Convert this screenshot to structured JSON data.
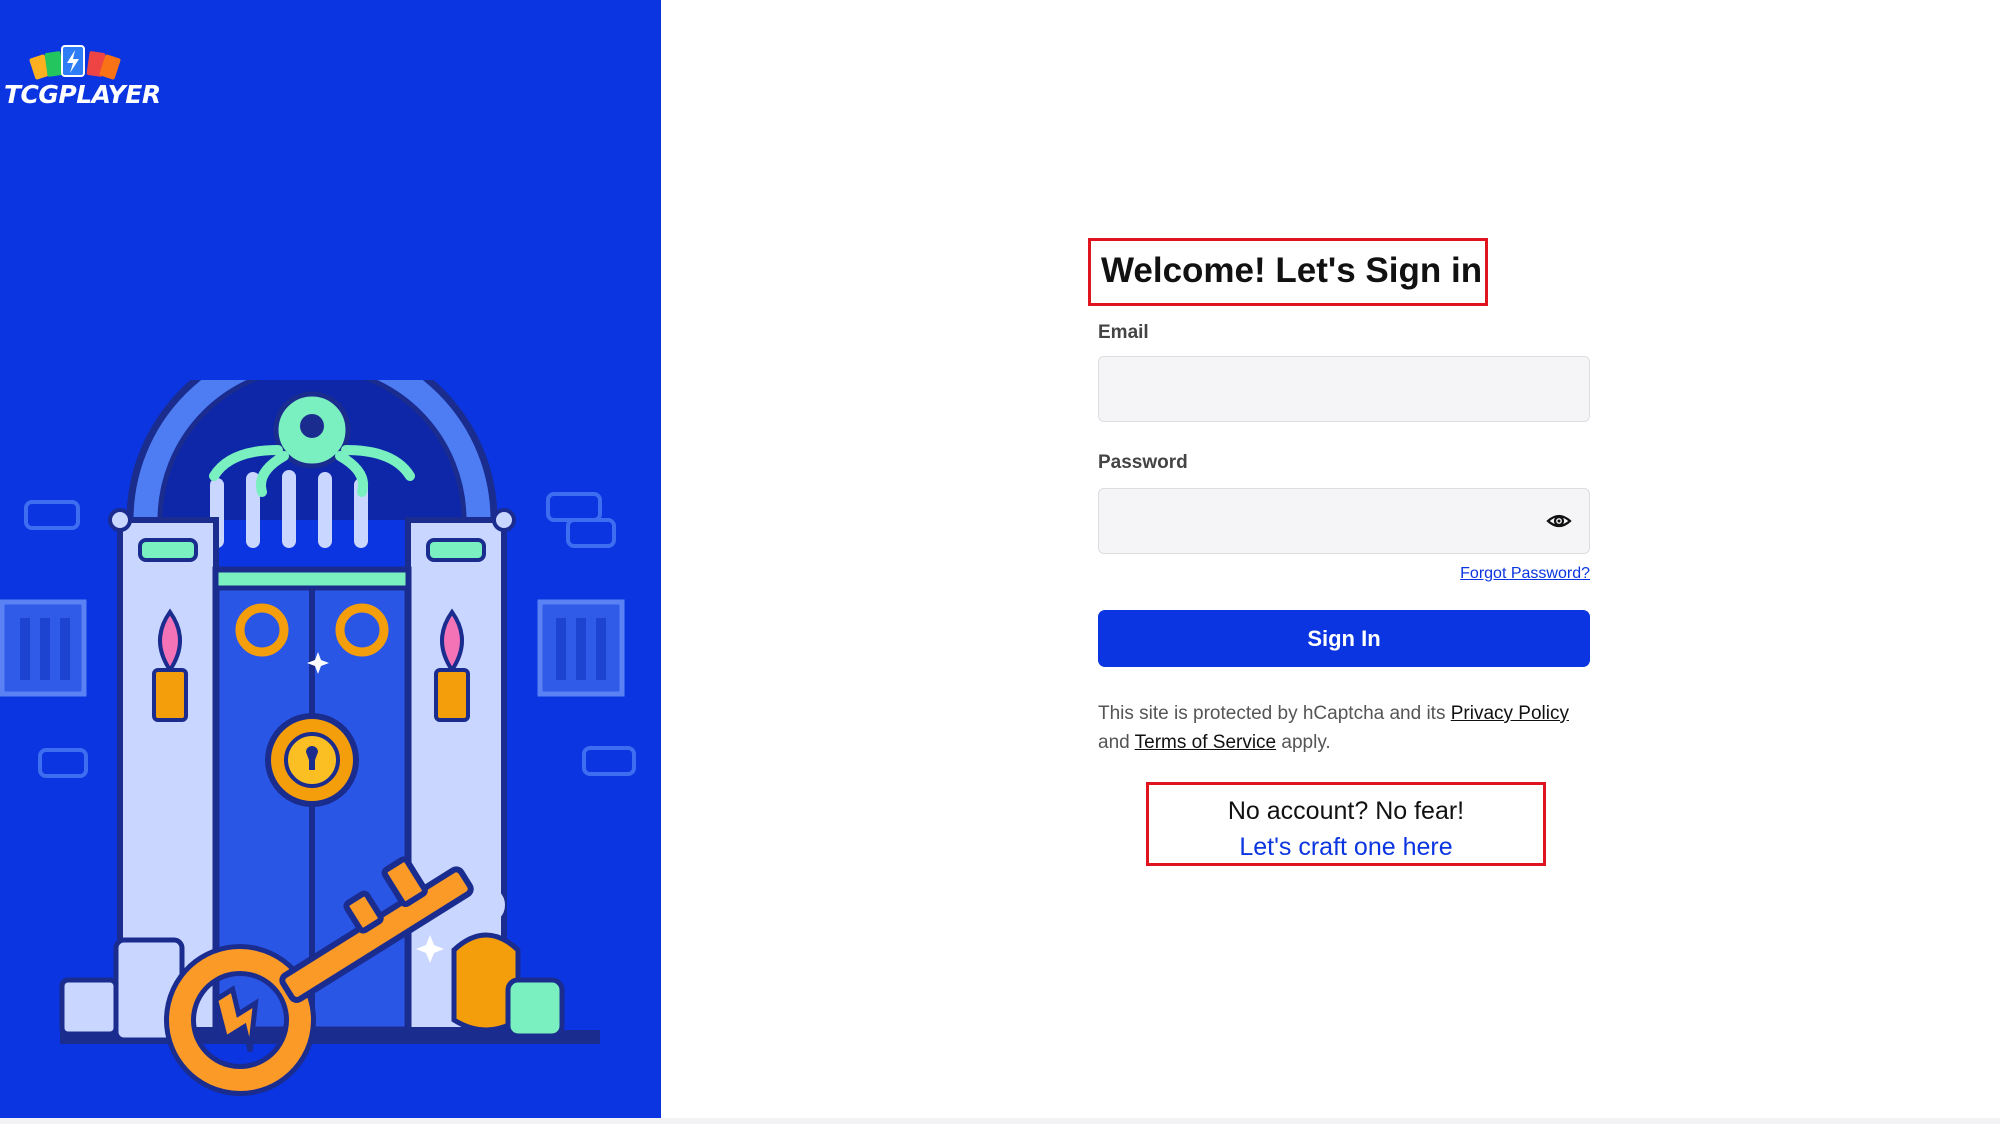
{
  "brand": {
    "name": "TCGPLAYER"
  },
  "form": {
    "title": "Welcome! Let's Sign in",
    "email_label": "Email",
    "email_value": "",
    "password_label": "Password",
    "password_value": "",
    "forgot_password": "Forgot Password?",
    "sign_in": "Sign In",
    "captcha_prefix": "This site is protected by hCaptcha and its ",
    "privacy_policy": "Privacy Policy",
    "captcha_and": " and ",
    "terms_of_service": "Terms of Service",
    "captcha_suffix": " apply.",
    "no_account": "No account? No fear!",
    "create_account": "Let's craft one here"
  },
  "colors": {
    "brand_blue": "#0a35e0",
    "highlight_red": "#e0141e"
  },
  "icons": {
    "password_toggle": "eye-icon"
  }
}
